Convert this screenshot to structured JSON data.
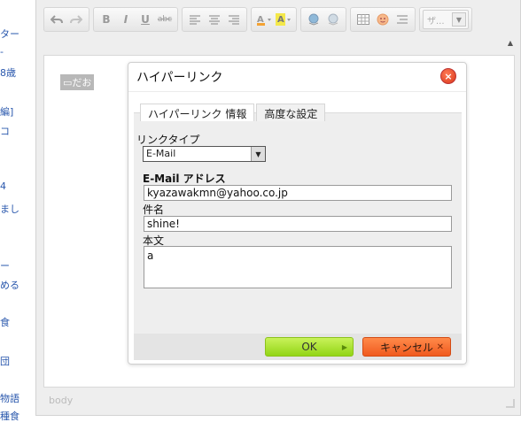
{
  "left_page": {
    "fragments": [
      {
        "text": "ター"
      },
      {
        "text": "-"
      },
      {
        "text": "8歳"
      },
      {
        "text": "編]"
      },
      {
        "text": "コ"
      },
      {
        "text": "4"
      },
      {
        "text": "まし"
      },
      {
        "text": "ー"
      },
      {
        "text": "める"
      },
      {
        "text": "食"
      },
      {
        "text": "団"
      },
      {
        "text": "物語"
      },
      {
        "text": "種食"
      }
    ]
  },
  "toolbar": {
    "bold": "B",
    "italic": "I",
    "underline": "U",
    "strike": "abc",
    "style_combo": "ザ..."
  },
  "editor": {
    "placeholder_tag": "▭だお",
    "status_path": "body"
  },
  "dialog": {
    "title": "ハイパーリンク",
    "tabs": [
      {
        "label": "ハイパーリンク 情報",
        "active": true
      },
      {
        "label": "高度な設定",
        "active": false
      }
    ],
    "link_type_label": "リンクタイプ",
    "link_type_value": "E-Mail",
    "email_label": "E-Mail アドレス",
    "email_value": "kyazawakmn@yahoo.co.jp",
    "subject_label": "件名",
    "subject_value": "shine!",
    "body_label": "本文",
    "body_value": "a",
    "ok_label": "OK",
    "cancel_label": "キャンセル"
  },
  "colors": {
    "ok_button": "#a6e22e",
    "cancel_button": "#f26a2a",
    "close_button": "#e8482a",
    "link_text": "#2a58ad"
  }
}
